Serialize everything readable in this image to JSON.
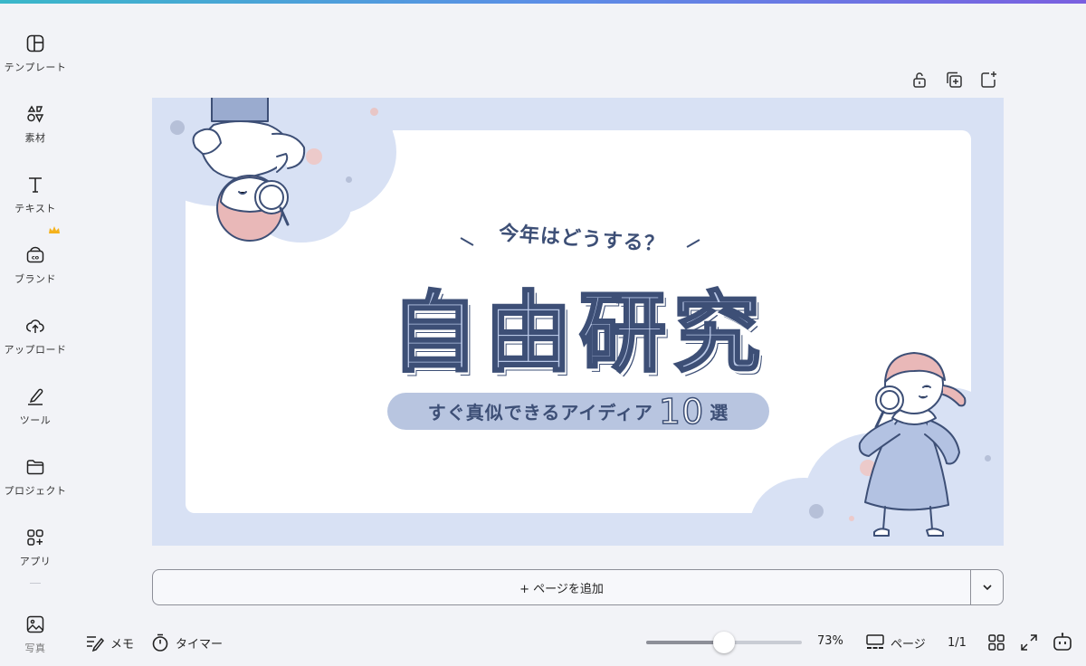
{
  "sidebar": {
    "items": [
      {
        "label": "テンプレート",
        "icon": "template-icon"
      },
      {
        "label": "素材",
        "icon": "elements-icon"
      },
      {
        "label": "テキスト",
        "icon": "text-icon"
      },
      {
        "label": "ブランド",
        "icon": "brand-icon"
      },
      {
        "label": "アップロード",
        "icon": "upload-icon"
      },
      {
        "label": "ツール",
        "icon": "tools-icon"
      },
      {
        "label": "プロジェクト",
        "icon": "folder-icon"
      },
      {
        "label": "アプリ",
        "icon": "apps-icon"
      },
      {
        "label": "写真",
        "icon": "photo-icon"
      }
    ]
  },
  "design": {
    "subtitle": "今年はどうする？",
    "title": "自由研究",
    "pill_text": "すぐ真似できるアイディア",
    "pill_number": "10",
    "pill_suffix": "選"
  },
  "canvas": {
    "add_page_label": "+ ページを追加"
  },
  "bottom": {
    "memo_label": "メモ",
    "timer_label": "タイマー",
    "zoom_label": "73%",
    "zoom_level": 0.5,
    "pages_label": "ページ",
    "page_count": "1/1"
  },
  "colors": {
    "accent_navy": "#3d4f76",
    "canvas_bg": "#d8e1f4",
    "title_fill": "#b8c7e6"
  }
}
